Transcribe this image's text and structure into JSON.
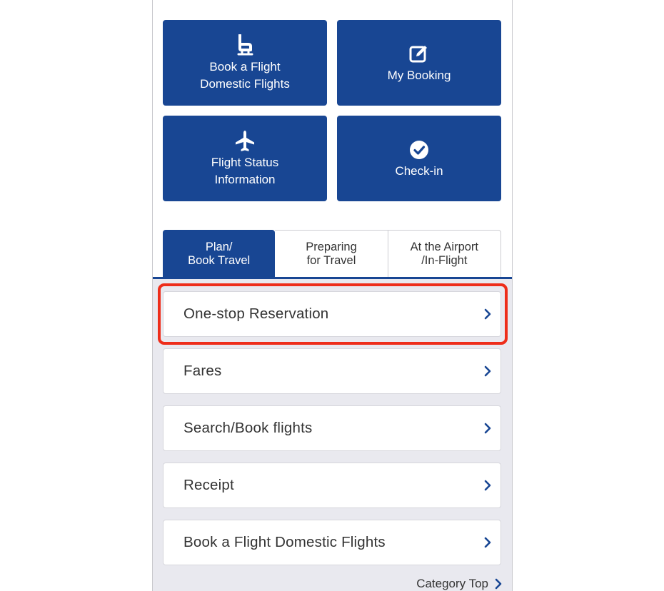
{
  "tiles": [
    {
      "id": "book-flight",
      "icon": "seat-icon",
      "lines": [
        "Book a Flight",
        "Domestic Flights"
      ]
    },
    {
      "id": "my-booking",
      "icon": "edit-icon",
      "lines": [
        "My Booking"
      ]
    },
    {
      "id": "flight-status",
      "icon": "airplane-icon",
      "lines": [
        "Flight Status",
        "Information"
      ]
    },
    {
      "id": "check-in",
      "icon": "check-circle-icon",
      "lines": [
        "Check-in"
      ]
    }
  ],
  "tabs": [
    {
      "line1": "Plan/",
      "line2": "Book Travel",
      "active": true
    },
    {
      "line1": "Preparing",
      "line2": "for Travel",
      "active": false
    },
    {
      "line1": "At the Airport",
      "line2": "/In-Flight",
      "active": false
    }
  ],
  "menu_items": [
    {
      "label": "One-stop Reservation",
      "highlighted": true
    },
    {
      "label": "Fares",
      "highlighted": false
    },
    {
      "label": "Search/Book flights",
      "highlighted": false
    },
    {
      "label": "Receipt",
      "highlighted": false
    },
    {
      "label": "Book a Flight Domestic Flights",
      "highlighted": false
    }
  ],
  "category_top_label": "Category Top",
  "colors": {
    "brand_navy": "#184693",
    "highlight_red": "#ee2d1a",
    "list_background": "#e9e9ef",
    "text": "#333333"
  }
}
